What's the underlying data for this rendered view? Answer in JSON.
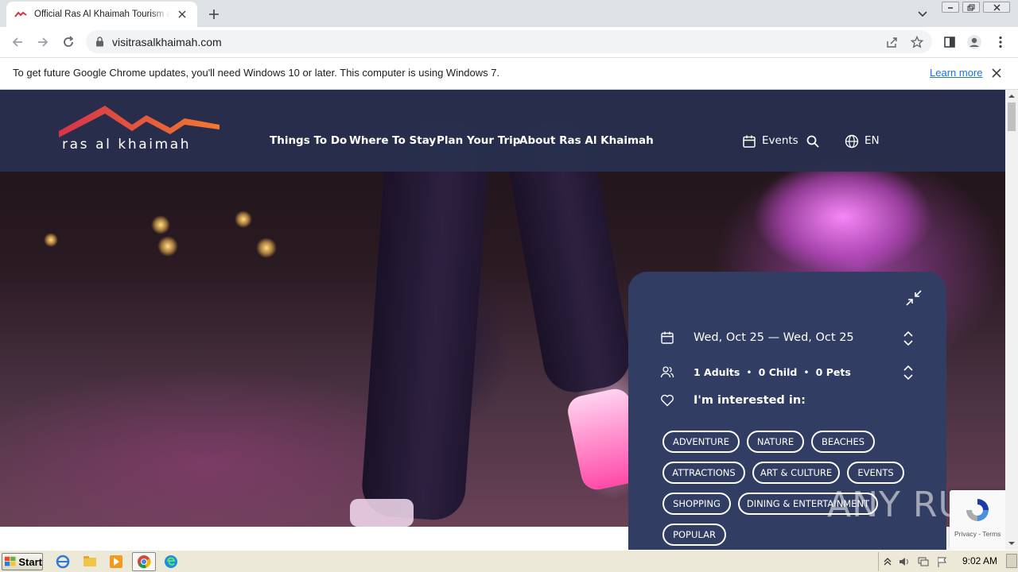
{
  "browser": {
    "tab_title": "Official Ras Al Khaimah Tourism and Visitor Website",
    "url": "visitrasalkhaimah.com",
    "infobar_text": "To get future Google Chrome updates, you'll need Windows 10 or later. This computer is using Windows 7.",
    "infobar_link": "Learn more"
  },
  "site": {
    "logo_text": "ras al khaimah",
    "brand_colors": {
      "header": "#28304e",
      "panel": "#313d62",
      "logo_red": "#d6334a",
      "logo_orange": "#f27a2f"
    },
    "nav": [
      "Things To Do",
      "Where To Stay",
      "Plan Your Trip",
      "About Ras Al Khaimah"
    ],
    "events_label": "Events",
    "language": "EN"
  },
  "booking": {
    "dates": "Wed, Oct 25 — Wed, Oct 25",
    "adults": "1 Adults",
    "children": "0 Child",
    "pets": "0 Pets",
    "separator": "•",
    "interested_label": "I'm interested in:",
    "chips": [
      "ADVENTURE",
      "NATURE",
      "BEACHES",
      "ATTRACTIONS",
      "ART & CULTURE",
      "EVENTS",
      "SHOPPING",
      "DINING & ENTERTAINMENT",
      "POPULAR"
    ]
  },
  "recaptcha": {
    "links": "Privacy - Terms"
  },
  "watermark": {
    "text": "ANY RUN"
  },
  "taskbar": {
    "start_label": "Start",
    "clock": "9:02 AM"
  }
}
